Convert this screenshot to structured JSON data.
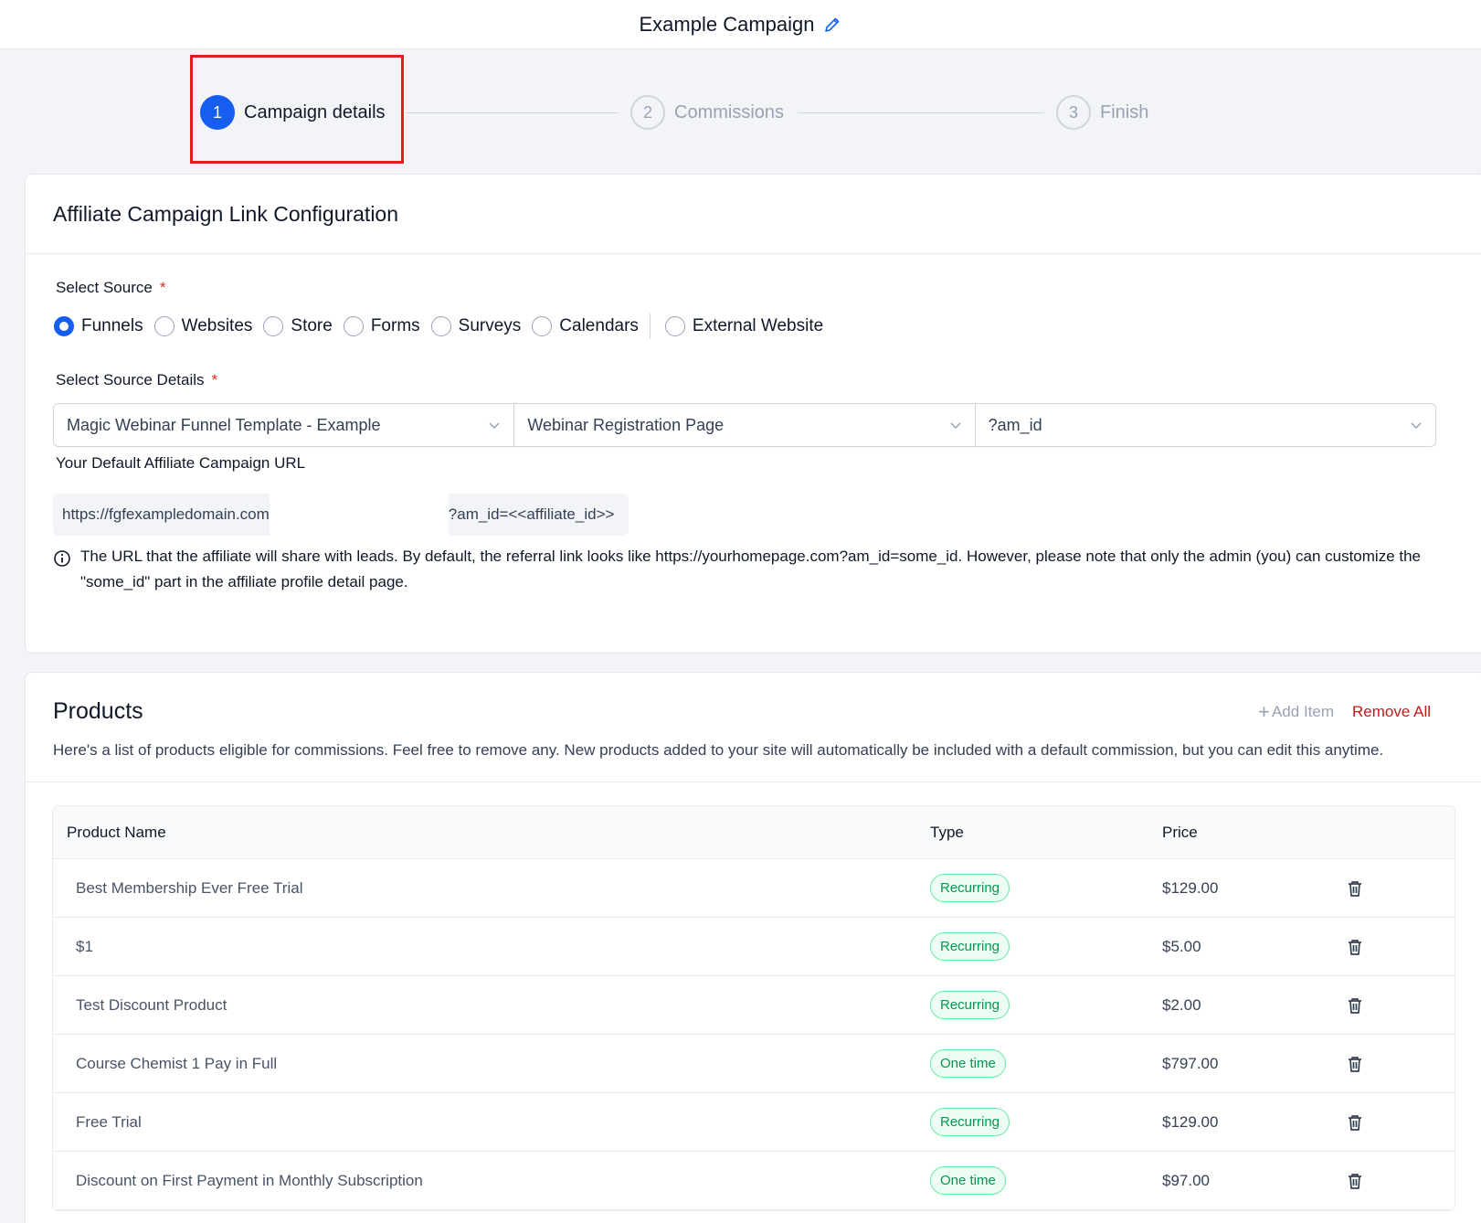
{
  "header": {
    "title": "Example Campaign",
    "edit_icon": "pencil-icon"
  },
  "stepper": {
    "steps": [
      {
        "number": "1",
        "label": "Campaign details",
        "state": "active"
      },
      {
        "number": "2",
        "label": "Commissions",
        "state": "inactive"
      },
      {
        "number": "3",
        "label": "Finish",
        "state": "inactive"
      }
    ]
  },
  "link_config": {
    "title": "Affiliate Campaign Link Configuration",
    "source_label": "Select Source",
    "required_mark": "*",
    "sources": [
      "Funnels",
      "Websites",
      "Store",
      "Forms",
      "Surveys",
      "Calendars",
      "External Website"
    ],
    "selected_source": "Funnels",
    "details_label": "Select Source Details",
    "selects": [
      "Magic Webinar Funnel Template - Example",
      "Webinar Registration Page",
      "?am_id"
    ],
    "url_label": "Your Default Affiliate Campaign URL",
    "url_prefix": "https://fgfexampledomain.com",
    "url_suffix": "?am_id=<<affiliate_id>>",
    "info_text": "The URL that the affiliate will share with leads. By default, the referral link looks like https://yourhomepage.com?am_id=some_id. However, please note that only the admin (you) can customize the \"some_id\" part in the affiliate profile detail page."
  },
  "products": {
    "title": "Products",
    "add_item_label": "Add Item",
    "remove_all_label": "Remove All",
    "description": "Here's a list of products eligible for commissions. Feel free to remove any. New products added to your site will automatically be included with a default commission, but you can edit this anytime.",
    "columns": [
      "Product Name",
      "Type",
      "Price"
    ],
    "rows": [
      {
        "name": "Best Membership Ever Free Trial",
        "type": "Recurring",
        "price": "$129.00"
      },
      {
        "name": "$1",
        "type": "Recurring",
        "price": "$5.00"
      },
      {
        "name": "Test Discount Product",
        "type": "Recurring",
        "price": "$2.00"
      },
      {
        "name": "Course Chemist 1 Pay in Full",
        "type": "One time",
        "price": "$797.00"
      },
      {
        "name": "Free Trial",
        "type": "Recurring",
        "price": "$129.00"
      },
      {
        "name": "Discount on First Payment in Monthly Subscription",
        "type": "One time",
        "price": "$97.00"
      }
    ]
  },
  "colors": {
    "primary": "#155eef",
    "danger": "#c01b1b",
    "success": "#039855",
    "highlight": "#e11d1d"
  }
}
